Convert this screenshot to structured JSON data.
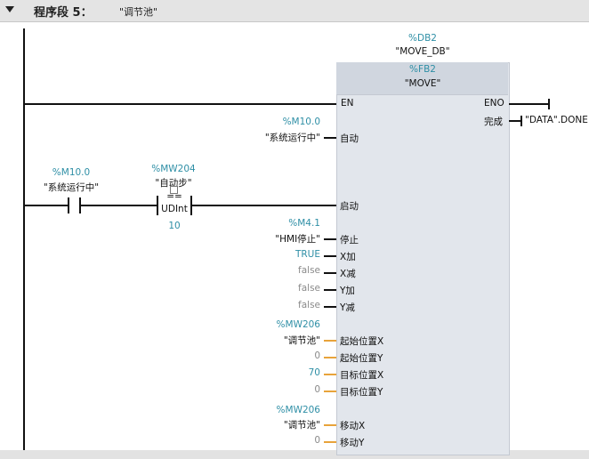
{
  "header": {
    "title": "程序段 5：",
    "name": "\"调节池\""
  },
  "instance_db": {
    "address": "%DB2",
    "name": "\"MOVE_DB\""
  },
  "function_block": {
    "address": "%FB2",
    "name": "\"MOVE\""
  },
  "pins": {
    "en": "EN",
    "eno": "ENO",
    "done": "完成",
    "done_tag": "\"DATA\".DONE",
    "auto": "自动",
    "start": "启动",
    "stop": "停止",
    "x_plus": "X加",
    "x_minus": "X减",
    "y_plus": "Y加",
    "y_minus": "Y减",
    "start_x": "起始位置X",
    "start_y": "起始位置Y",
    "target_x": "目标位置X",
    "target_y": "目标位置Y",
    "move_x": "移动X",
    "move_y": "移动Y"
  },
  "params": {
    "auto_addr": "%M10.0",
    "auto_name": "\"系统运行中\"",
    "stop_addr": "%M4.1",
    "stop_name": "\"HMI停止\"",
    "x_plus": "TRUE",
    "x_minus": "false",
    "y_plus": "false",
    "y_minus": "false",
    "start_x_addr": "%MW206",
    "start_x_name": "\"调节池\"",
    "start_y": "0",
    "target_x": "70",
    "target_y": "0",
    "move_x_addr": "%MW206",
    "move_x_name": "\"调节池\"",
    "move_y": "0"
  },
  "contact": {
    "address": "%M10.0",
    "name": "\"系统运行中\""
  },
  "compare": {
    "address": "%MW204",
    "name": "\"自动步\"",
    "operator": "==",
    "type": "UDInt",
    "value": "10"
  }
}
